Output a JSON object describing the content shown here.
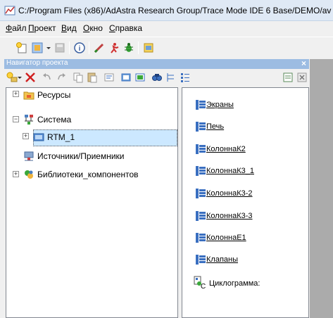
{
  "window": {
    "title": "C:/Program Files (x86)/AdAstra Research Group/Trace Mode IDE 6 Base/DEMO/av"
  },
  "menu": [
    {
      "label": "Файл",
      "u": "Ф",
      "rest": "айл"
    },
    {
      "label": "Проект",
      "u": "П",
      "rest": "роект"
    },
    {
      "label": "Вид",
      "u": "В",
      "rest": "ид"
    },
    {
      "label": "Окно",
      "u": "О",
      "rest": "кно"
    },
    {
      "label": "Справка",
      "u": "С",
      "rest": "правка"
    }
  ],
  "navigator": {
    "title": "Навигатор проекта",
    "close": "×"
  },
  "tree": {
    "items": [
      {
        "label": "Ресурсы",
        "icon": "folder-icon",
        "expander": "+"
      },
      {
        "label": "Система",
        "icon": "network-icon",
        "expander": "−"
      },
      {
        "label": "RTM_1",
        "icon": "rtm-icon",
        "expander": "+"
      },
      {
        "label": "Источники/Приемники",
        "icon": "io-icon",
        "expander": ""
      },
      {
        "label": "Библиотеки_компонентов",
        "icon": "library-icon",
        "expander": "+"
      }
    ]
  },
  "content": {
    "items": [
      {
        "label": "Экраны",
        "icon": "screen-icon"
      },
      {
        "label": "Печь",
        "icon": "screen-icon"
      },
      {
        "label": "КолоннаК2",
        "icon": "screen-icon"
      },
      {
        "label": "КолоннаК3_1",
        "icon": "screen-icon"
      },
      {
        "label": "КолоннаК3-2",
        "icon": "screen-icon"
      },
      {
        "label": "КолоннаК3-3",
        "icon": "screen-icon"
      },
      {
        "label": "КолоннаЕ1",
        "icon": "screen-icon"
      },
      {
        "label": "Клапаны",
        "icon": "screen-icon"
      },
      {
        "label": "Циклограмма:",
        "icon": "program-c-icon",
        "extra": "C"
      }
    ]
  }
}
